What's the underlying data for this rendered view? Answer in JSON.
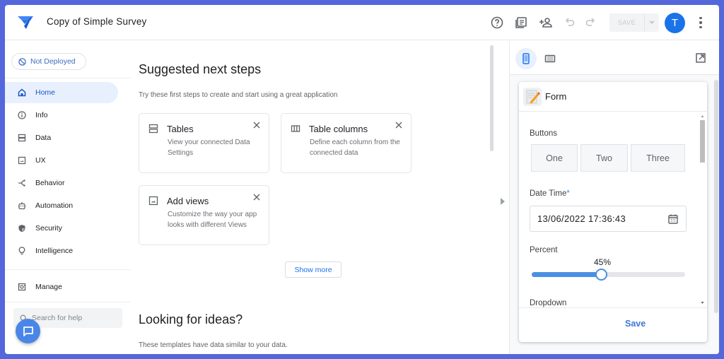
{
  "header": {
    "app_title": "Copy of Simple Survey",
    "icons": [
      "help-icon",
      "documentation-icon",
      "share-icon",
      "undo-icon",
      "redo-icon"
    ],
    "save_label": "SAVE",
    "avatar_initial": "T",
    "colors": {
      "brand": "#1a73e8",
      "frame": "#5468dc"
    }
  },
  "sidebar": {
    "deploy_status": "Not Deployed",
    "items": [
      {
        "label": "Home",
        "icon": "home-icon",
        "active": true
      },
      {
        "label": "Info",
        "icon": "info-icon"
      },
      {
        "label": "Data",
        "icon": "data-icon"
      },
      {
        "label": "UX",
        "icon": "ux-icon"
      },
      {
        "label": "Behavior",
        "icon": "behavior-icon"
      },
      {
        "label": "Automation",
        "icon": "automation-icon"
      },
      {
        "label": "Security",
        "icon": "security-icon"
      },
      {
        "label": "Intelligence",
        "icon": "intelligence-icon"
      }
    ],
    "manage_label": "Manage",
    "help_search_placeholder": "Search for help"
  },
  "main": {
    "suggested": {
      "title": "Suggested next steps",
      "subtitle": "Try these first steps to create and start using a great application",
      "cards": [
        {
          "title": "Tables",
          "desc": "View your connected Data Settings",
          "icon": "tables-icon"
        },
        {
          "title": "Table columns",
          "desc": "Define each column from the connected data",
          "icon": "columns-icon"
        },
        {
          "title": "Add views",
          "desc": "Customize the way your app looks with different Views",
          "icon": "views-icon"
        }
      ],
      "show_more": "Show more"
    },
    "ideas": {
      "title": "Looking for ideas?",
      "subtitle": "These templates have data similar to your data."
    }
  },
  "preview": {
    "form": {
      "title": "Form",
      "buttons_label": "Buttons",
      "buttons": [
        "One",
        "Two",
        "Three"
      ],
      "datetime_label": "Date Time",
      "datetime_required": "*",
      "datetime_value": "13/06/2022 17:36:43",
      "percent_label": "Percent",
      "percent_value": 45,
      "percent_display": "45%",
      "dropdown_label": "Dropdown",
      "save_label": "Save"
    }
  }
}
